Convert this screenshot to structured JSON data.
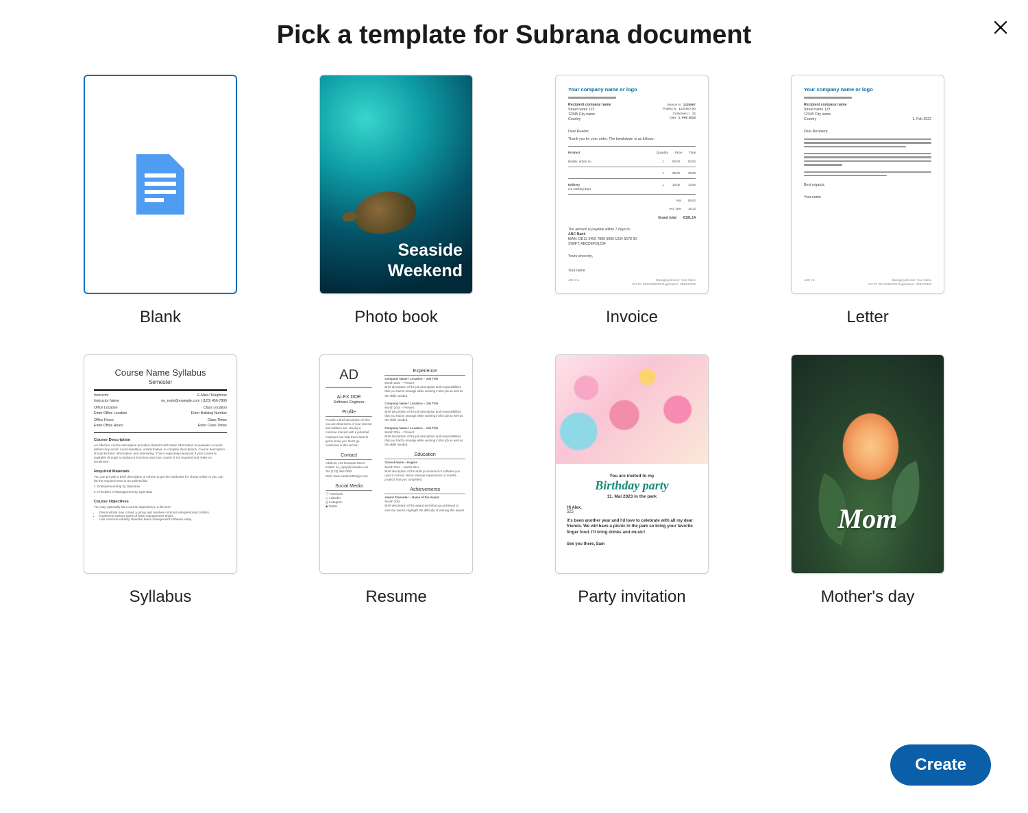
{
  "dialog": {
    "title": "Pick a template for Subrana document",
    "create_label": "Create"
  },
  "templates": [
    {
      "id": "blank",
      "label": "Blank",
      "selected": true
    },
    {
      "id": "photo-book",
      "label": "Photo book",
      "selected": false,
      "preview": {
        "line1": "Seaside",
        "line2": "Weekend"
      }
    },
    {
      "id": "invoice",
      "label": "Invoice",
      "selected": false,
      "preview": {
        "company_line": "Your company name or logo",
        "recipient_heading": "Recipient company name",
        "recipient_l1": "Street name 123",
        "recipient_l2": "12345 City name",
        "recipient_l3": "Country",
        "meta_invoice_no_label": "Invoice N.",
        "meta_invoice_no_value": "1234567",
        "meta_project_label": "Project N.",
        "meta_project_value": "1234567.90",
        "meta_customer_label": "Customer n.",
        "meta_customer_value": "15",
        "meta_date_label": "Date",
        "meta_date_value": "1. Feb 2023",
        "greeting": "Dear Reader,",
        "intro": "Thank you for your order. The breakdown is as follows:",
        "col_product": "Product",
        "col_qty": "Quantity",
        "col_price": "Price",
        "col_total": "Total",
        "row1_desc": "Details, article no.",
        "row1_qty": "1",
        "row1_price": "50.00",
        "row1_total": "50.00",
        "row2_qty": "1",
        "row2_price": "25.00",
        "row2_total": "25.00",
        "delivery_label": "Delivery",
        "delivery_desc": "2-3 working days",
        "delivery_qty": "1",
        "delivery_price": "10.00",
        "delivery_total": "10.00",
        "net_label": "Net",
        "net_value": "85.00",
        "vat_label": "VAT 19%",
        "vat_value": "16.14",
        "grand_label": "Grand total",
        "grand_value": "€101.14",
        "payable": "The amount is payable within 7 days to:",
        "bank_name": "ABC Bank",
        "iban": "IBAN: DE12 3456 7890 0000 1234 5678 90",
        "swift": "SWIFT: ABCDEFG1234",
        "signoff": "Yours sincerely,",
        "footer_left": "ABC Inc.",
        "footer_right1": "Managing director: Your Name",
        "footer_right2": "VAT ID: DE123456789  Registration: HRB123456"
      }
    },
    {
      "id": "letter",
      "label": "Letter",
      "selected": false,
      "preview": {
        "company_line": "Your company name or logo",
        "recipient_heading": "Recipient company name",
        "recipient_l1": "Street name 123",
        "recipient_l2": "12345 City name",
        "recipient_l3": "Country",
        "date": "1. Feb 2023",
        "greeting": "Dear Recipient,",
        "signoff": "Best regards,",
        "sender": "Your name",
        "footer_left": "ABC Inc.",
        "footer_right1": "Managing director: Your Name",
        "footer_right2": "VAT ID: DE123456789  Registration: HRB123456"
      }
    },
    {
      "id": "syllabus",
      "label": "Syllabus",
      "selected": false,
      "preview": {
        "title": "Course Name Syllabus",
        "semester": "Semester",
        "meta": {
          "instructor_label": "Instructor",
          "instructor_value": "Instructor Name",
          "email_label": "E-Mail / Telephone",
          "email_value": "no_reply@example.com | (123) 456-7890",
          "office_loc_label": "Office Location",
          "office_loc_value": "Enter Office Location",
          "class_loc_label": "Class Location",
          "class_loc_value": "Enter Building Number",
          "office_hours_label": "Office Hours",
          "office_hours_value": "Enter Office Hours",
          "class_times_label": "Class Times",
          "class_times_value": "Enter Class Times"
        },
        "sect_desc": "Course Description",
        "desc_text": "An effective course description provides students with basic information to evaluate a course before they enroll. Avoid repetitive, uninformative, or complex descriptions. Course description should be brief, informative, and interesting. This is especially important if your course is available through a catalog or brochure and your course is not required and relies on enrollment.",
        "sect_req": "Required Materials",
        "req_text": "You can provide a brief description on where to get the textbooks for cheap online or you can list the required texts in an ordered list.",
        "req_item1": "1. Entrepreneurship by Openstax",
        "req_item2": "2. Principles of Management by Openstax",
        "sect_obj": "Course Objectives",
        "obj_text": "You may optionally list a course objectives in a list here",
        "obj_item1": "Demonstrate how to lead a group and resolves common interpersonal conflicts.",
        "obj_item2": "Implement various types of team management styles.",
        "obj_item3": "Use common industry standard team management software today."
      }
    },
    {
      "id": "resume",
      "label": "Resume",
      "selected": false,
      "preview": {
        "initials": "AD",
        "name": "ALEX DOE",
        "role": "Software Engineer",
        "sect_profile": "Profile",
        "profile_text": "Provide a brief description of who you are what some of your interest and hobbies are. Having a common interest with a potential employer can help them want to get to know you. Don't go overboard in this section.",
        "sect_contact": "Contact",
        "addr": "Address: 123 Example Street",
        "email": "E-Mail: no_reply@example.com",
        "tel": "Tel: (123) 456-7890",
        "web": "Web: www.AlexDoeDesign.com",
        "sect_social": "Social Media",
        "sm_fb": "Facebook",
        "sm_li": "LinkedIn",
        "sm_ig": "Instagram",
        "sm_tw": "Twitter",
        "sect_exp": "Experience",
        "exp_heading": "Company Name / Location – Job Title",
        "exp_dates": "Month 20xx – Present",
        "exp_desc": "Brief description of the job description and responsibilities that you had to manage while working in this job as well as the skills needed.",
        "sect_edu": "Education",
        "edu_heading": "School Name – Degree",
        "edu_dates": "Month 20xx – Month 20xx",
        "edu_desc": "Brief description of the skills you learned or software you used in school. Name relevant experiences or real-life projects that you completed.",
        "sect_ach": "Achievements",
        "ach_heading": "Award Presenter – Name of the Award",
        "ach_date": "Month 20xx",
        "ach_desc": "Brief description of the award and what you achieved to earn the award. Highlight the difficulty of winning this award."
      }
    },
    {
      "id": "party-invitation",
      "label": "Party invitation",
      "selected": false,
      "preview": {
        "invite": "You are invited to my",
        "bp": "Birthday party",
        "date": "11. Mai 2023 in the park",
        "greet": "Hi Alex,",
        "msg": "it's been another year and I'd love to celebrate with all my dear friends. We will have a picnic in the park so bring your favorite finger food. I'll bring drinks and music!",
        "sign": "See you there, Sam"
      }
    },
    {
      "id": "mothers-day",
      "label": "Mother's day",
      "selected": false,
      "preview": {
        "text": "Mom"
      }
    }
  ]
}
